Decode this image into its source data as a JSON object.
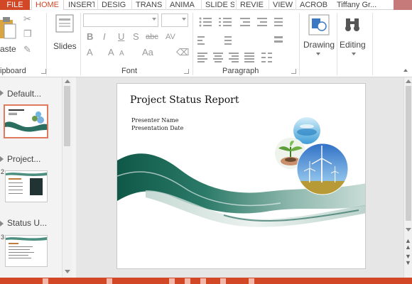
{
  "tabs": {
    "file": "FILE",
    "items": [
      {
        "label": "HOME",
        "active": true
      },
      {
        "label": "INSERT",
        "active": false
      },
      {
        "label": "DESIG",
        "active": false
      },
      {
        "label": "TRANS",
        "active": false
      },
      {
        "label": "ANIMA",
        "active": false
      },
      {
        "label": "SLIDE S",
        "active": false
      },
      {
        "label": "REVIE",
        "active": false
      },
      {
        "label": "VIEW",
        "active": false
      },
      {
        "label": "ACROB",
        "active": false
      }
    ],
    "user": "Tiffany Gr..."
  },
  "ribbon": {
    "clipboard": {
      "paste_label": "aste",
      "group_label": "ipboard"
    },
    "slides": {
      "new_slide_label": "Slides"
    },
    "font": {
      "group_label": "Font",
      "bold": "B",
      "italic": "I",
      "underline": "U",
      "shadow": "S",
      "strikethrough": "abc",
      "spacing": "AV",
      "font_color": "A",
      "grow": "A",
      "shrink": "A"
    },
    "paragraph": {
      "group_label": "Paragraph"
    },
    "drawing": {
      "label": "Drawing"
    },
    "editing": {
      "label": "Editing"
    }
  },
  "sections": [
    {
      "title": "Default..."
    },
    {
      "title": "Project..."
    },
    {
      "title": "Status U..."
    }
  ],
  "slide": {
    "title": "Project Status Report",
    "presenter": "Presenter Name",
    "date": "Presentation Date"
  },
  "colors": {
    "accent": "#d24726",
    "selection": "#e07a5f",
    "wave_dark": "#1f5e52",
    "wave_light": "#7fb3a8"
  }
}
